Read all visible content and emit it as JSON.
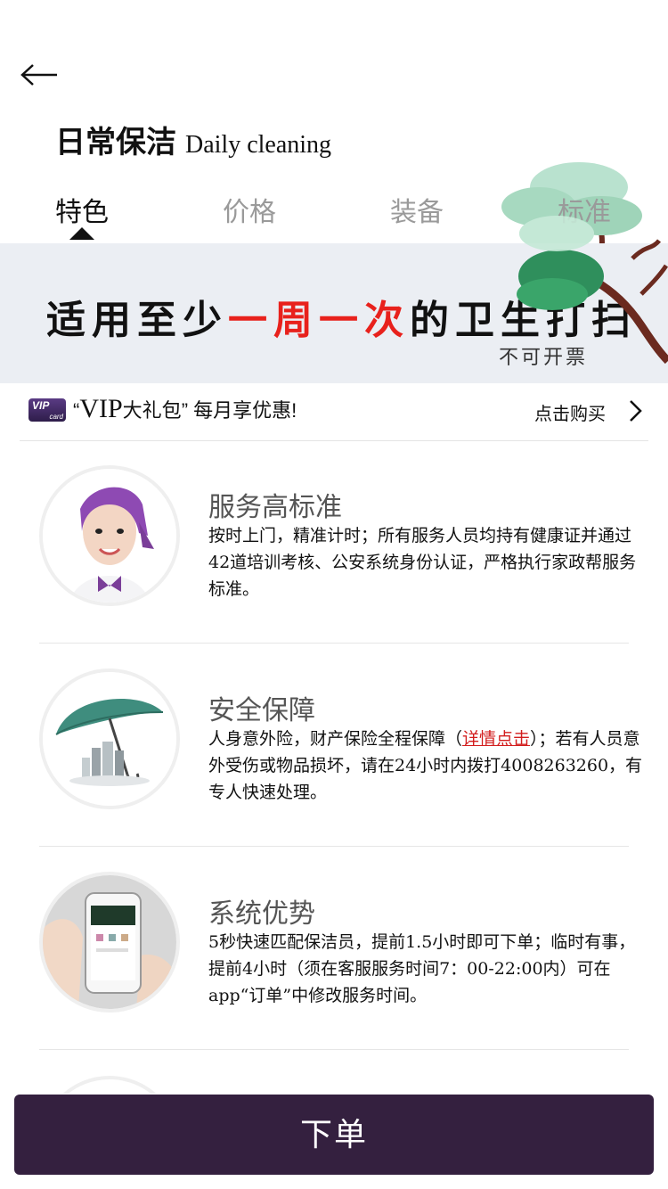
{
  "header": {
    "back_icon": "arrow-left-icon",
    "title_cn": "日常保洁",
    "title_en": "Daily cleaning"
  },
  "tabs": [
    {
      "label": "特色",
      "active": true
    },
    {
      "label": "价格",
      "active": false
    },
    {
      "label": "装备",
      "active": false
    },
    {
      "label": "标准",
      "active": false
    }
  ],
  "banner": {
    "text_part1": "适用至少",
    "text_highlight": "一周一次",
    "text_part2": "的卫生打扫",
    "note": "不可开票",
    "highlight_color": "#e8211c"
  },
  "vip": {
    "badge_top": "VIP",
    "badge_bottom": "card",
    "text_open_quote": "“",
    "text_vip": "VIP",
    "text_gift": "大礼包",
    "text_close_quote": "”",
    "text_rest": " 每月享优惠!",
    "buy_label": "点击购买",
    "arrow_icon": "chevron-right-icon"
  },
  "features": [
    {
      "title": "服务高标准",
      "desc": "按时上门，精准计时；所有服务人员均持有健康证并通过42道培训考核、公安系统身份认证，严格执行家政帮服务标准。",
      "icon": "housekeeper-photo"
    },
    {
      "title": "安全保障",
      "desc_before": "人身意外险，财产保险全程保障（",
      "link": "详情点击",
      "desc_after": "）；若有人员意外受伤或物品损坏，请在24小时内拨打4008263260，有专人快速处理。",
      "icon": "umbrella-icon"
    },
    {
      "title": "系统优势",
      "desc": "5秒快速匹配保洁员，提前1.5小时即可下单；临时有事，提前4小时（须在客服服务时间7：00-22:00内）可在app“订单”中修改服务时间。",
      "icon": "phone-app-photo"
    }
  ],
  "order_button": {
    "label": "下单"
  },
  "colors": {
    "accent": "#34203f",
    "banner_bg": "#ebeef3",
    "link": "#d21d1d"
  }
}
